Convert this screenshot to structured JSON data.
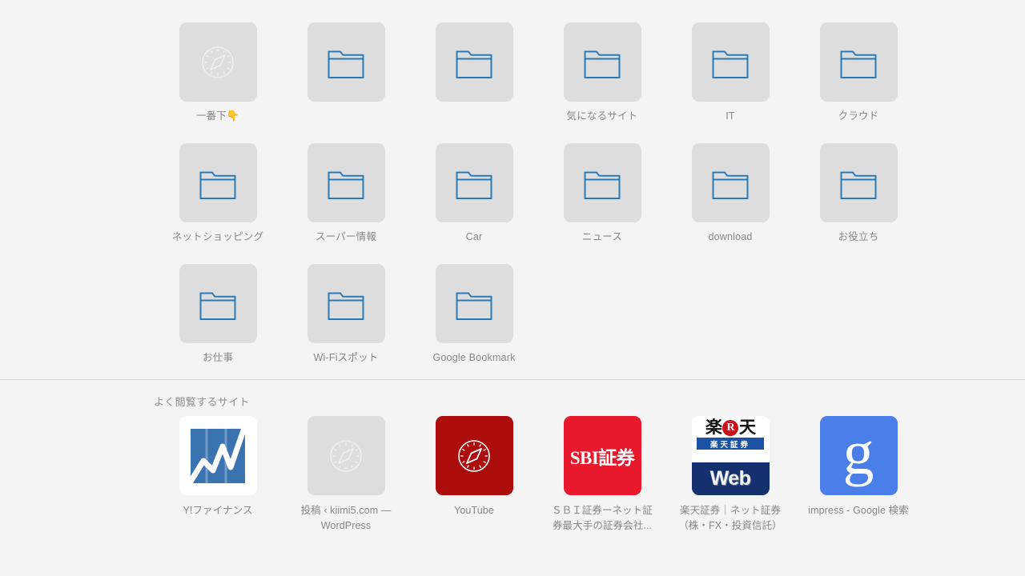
{
  "page": {
    "background_color": "#f4f4f4",
    "tile_color": "#dddddd",
    "label_color": "#868686"
  },
  "favorites": {
    "rows": [
      [
        {
          "label": "一番下",
          "emoji": "👇",
          "icon": "compass-icon",
          "icon_style": "placeholder"
        },
        {
          "label": "",
          "icon": "folder-icon",
          "icon_style": "folder"
        },
        {
          "label": "",
          "icon": "folder-icon",
          "icon_style": "folder"
        },
        {
          "label": "気になるサイト",
          "icon": "folder-icon",
          "icon_style": "folder"
        },
        {
          "label": "IT",
          "icon": "folder-icon",
          "icon_style": "folder"
        },
        {
          "label": "クラウド",
          "icon": "folder-icon",
          "icon_style": "folder"
        }
      ],
      [
        {
          "label": "ネットショッピング",
          "icon": "folder-icon",
          "icon_style": "folder"
        },
        {
          "label": "スーパー情報",
          "icon": "folder-icon",
          "icon_style": "folder"
        },
        {
          "label": "Car",
          "icon": "folder-icon",
          "icon_style": "folder"
        },
        {
          "label": "ニュース",
          "icon": "folder-icon",
          "icon_style": "folder"
        },
        {
          "label": "download",
          "icon": "folder-icon",
          "icon_style": "folder"
        },
        {
          "label": "お役立ち",
          "icon": "folder-icon",
          "icon_style": "folder"
        }
      ],
      [
        {
          "label": "お仕事",
          "icon": "folder-icon",
          "icon_style": "folder"
        },
        {
          "label": "Wi-Fiスポット",
          "icon": "folder-icon",
          "icon_style": "folder"
        },
        {
          "label": "Google Bookmark",
          "icon": "folder-icon",
          "icon_style": "folder"
        }
      ]
    ]
  },
  "frequent": {
    "title": "よく閲覧するサイト",
    "sites": [
      {
        "label": "Y!ファイナンス",
        "icon": "yahoo-finance-chart-icon",
        "tile_color": "#ffffff",
        "accent_color": "#3b72b0"
      },
      {
        "label_line1": "投稿 ‹ kiimi5.com —",
        "label_line2": "WordPress",
        "icon": "compass-icon",
        "tile_color": "#dddddd"
      },
      {
        "label": "YouTube",
        "icon": "compass-icon",
        "tile_color": "#ac0c0c"
      },
      {
        "label_line1": "ＳＢＩ証券ーネット証",
        "label_line2": "券最大手の証券会社...",
        "icon": "sbi-logo-icon",
        "icon_text": "SBI証券",
        "tile_color": "#e8192c"
      },
      {
        "label_line1": "楽天証券｜ネット証券",
        "label_line2": "（株・FX・投資信託）",
        "icon": "rakuten-logo-icon",
        "logo_top_left": "楽",
        "logo_top_mark": "R",
        "logo_top_right": "天",
        "logo_sub": "楽天証券",
        "logo_bottom": "Web",
        "tile_color": "#ffffff"
      },
      {
        "label": "impress - Google 検索",
        "icon": "google-logo-icon",
        "icon_text": "g",
        "tile_color": "#4a7ee8"
      }
    ]
  }
}
